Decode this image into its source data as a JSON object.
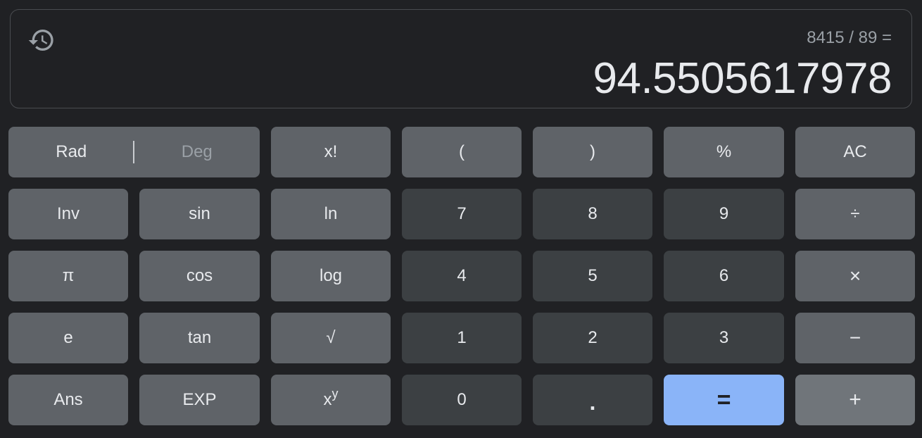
{
  "display": {
    "history_icon": "history-icon",
    "expression": "8415 / 89 =",
    "result": "94.5505617978"
  },
  "keys": {
    "rad": "Rad",
    "deg": "Deg",
    "factorial": "x!",
    "open_paren": "(",
    "close_paren": ")",
    "percent": "%",
    "clear": "AC",
    "inv": "Inv",
    "sin": "sin",
    "ln": "ln",
    "seven": "7",
    "eight": "8",
    "nine": "9",
    "divide": "÷",
    "pi": "π",
    "cos": "cos",
    "log": "log",
    "four": "4",
    "five": "5",
    "six": "6",
    "multiply": "×",
    "e": "e",
    "tan": "tan",
    "sqrt": "√",
    "one": "1",
    "two": "2",
    "three": "3",
    "minus": "−",
    "ans": "Ans",
    "exp": "EXP",
    "power_base": "x",
    "power_exp": "y",
    "zero": "0",
    "decimal": ".",
    "equals": "=",
    "plus": "+"
  },
  "colors": {
    "background": "#202124",
    "function_key": "#5f6368",
    "number_key": "#3c4043",
    "equals_key": "#8ab4f8",
    "text": "#e8eaed",
    "muted_text": "#9aa0a6"
  }
}
